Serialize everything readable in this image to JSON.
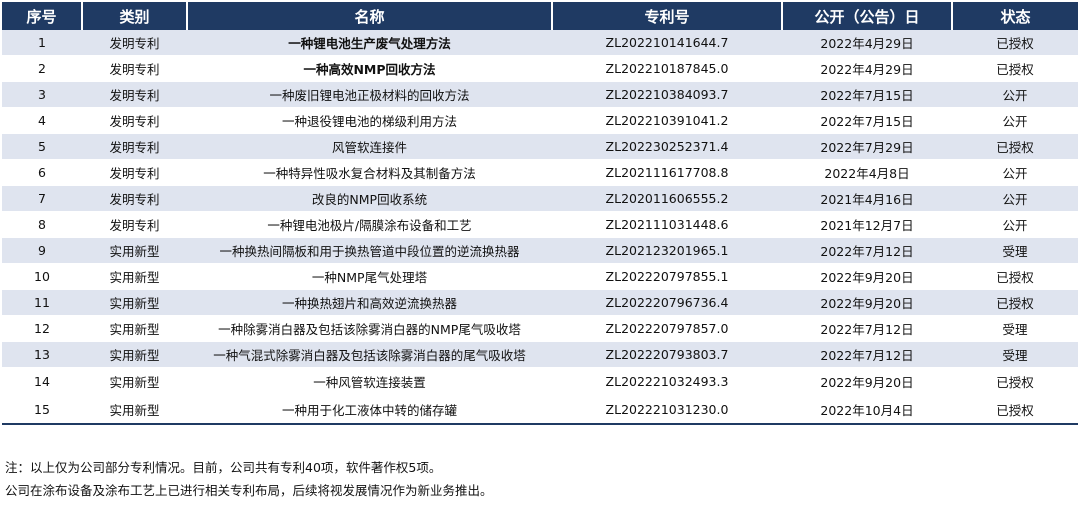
{
  "table": {
    "headers": [
      "序号",
      "类别",
      "名称",
      "专利号",
      "公开（公告）日",
      "状态"
    ],
    "rows": [
      {
        "no": "1",
        "category": "发明专利",
        "name": "一种锂电池生产废气处理方法",
        "patent_no": "ZL202210141644.7",
        "date": "2022年4月29日",
        "status": "已授权"
      },
      {
        "no": "2",
        "category": "发明专利",
        "name": "一种高效NMP回收方法",
        "patent_no": "ZL202210187845.0",
        "date": "2022年4月29日",
        "status": "已授权"
      },
      {
        "no": "3",
        "category": "发明专利",
        "name": "一种废旧锂电池正极材料的回收方法",
        "patent_no": "ZL202210384093.7",
        "date": "2022年7月15日",
        "status": "公开"
      },
      {
        "no": "4",
        "category": "发明专利",
        "name": "一种退役锂电池的梯级利用方法",
        "patent_no": "ZL202210391041.2",
        "date": "2022年7月15日",
        "status": "公开"
      },
      {
        "no": "5",
        "category": "发明专利",
        "name": "风管软连接件",
        "patent_no": "ZL202230252371.4",
        "date": "2022年7月29日",
        "status": "已授权"
      },
      {
        "no": "6",
        "category": "发明专利",
        "name": "一种特异性吸水复合材料及其制备方法",
        "patent_no": "ZL202111617708.8",
        "date": "2022年4月8日",
        "status": "公开"
      },
      {
        "no": "7",
        "category": "发明专利",
        "name": "改良的NMP回收系统",
        "patent_no": "ZL202011606555.2",
        "date": "2021年4月16日",
        "status": "公开"
      },
      {
        "no": "8",
        "category": "发明专利",
        "name": "一种锂电池极片/隔膜涂布设备和工艺",
        "patent_no": "ZL202111031448.6",
        "date": "2021年12月7日",
        "status": "公开"
      },
      {
        "no": "9",
        "category": "实用新型",
        "name": "一种换热间隔板和用于换热管道中段位置的逆流换热器",
        "patent_no": "ZL202123201965.1",
        "date": "2022年7月12日",
        "status": "受理"
      },
      {
        "no": "10",
        "category": "实用新型",
        "name": "一种NMP尾气处理塔",
        "patent_no": "ZL202220797855.1",
        "date": "2022年9月20日",
        "status": "已授权"
      },
      {
        "no": "11",
        "category": "实用新型",
        "name": "一种换热翅片和高效逆流换热器",
        "patent_no": "ZL202220796736.4",
        "date": "2022年9月20日",
        "status": "已授权"
      },
      {
        "no": "12",
        "category": "实用新型",
        "name": "一种除雾消白器及包括该除雾消白器的NMP尾气吸收塔",
        "patent_no": "ZL202220797857.0",
        "date": "2022年7月12日",
        "status": "受理"
      },
      {
        "no": "13",
        "category": "实用新型",
        "name": "一种气混式除雾消白器及包括该除雾消白器的尾气吸收塔",
        "patent_no": "ZL202220793803.7",
        "date": "2022年7月12日",
        "status": "受理"
      },
      {
        "no": "14",
        "category": "实用新型",
        "name": "一种风管软连接装置",
        "patent_no": "ZL202221032493.3",
        "date": "2022年9月20日",
        "status": "已授权"
      },
      {
        "no": "15",
        "category": "实用新型",
        "name": "一种用于化工液体中转的储存罐",
        "patent_no": "ZL202221031230.0",
        "date": "2022年10月4日",
        "status": "已授权"
      }
    ]
  },
  "notes": [
    "注：以上仅为公司部分专利情况。目前，公司共有专利40项，软件著作权5项。",
    "公司在涂布设备及涂布工艺上已进行相关专利布局，后续将视发展情况作为新业务推出。"
  ],
  "colors": {
    "header_bg": "#1f3a63",
    "shaded_row": "#dfe4ef"
  }
}
